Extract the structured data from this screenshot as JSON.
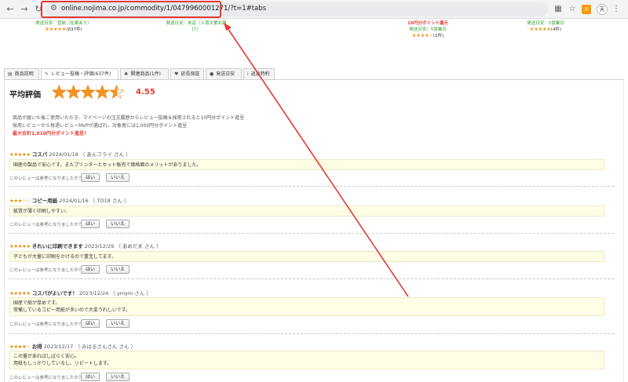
{
  "browser": {
    "url": "online.nojima.co.jp/commodity/1/0479960001271/?t=1#tabs",
    "avatar_text": "天",
    "extension_badge": "8",
    "icons": [
      "back-icon",
      "forward-icon",
      "reload-icon",
      "site-settings-icon",
      "qr-icon",
      "bookmark-star-icon",
      "extensions-icon",
      "avatar",
      "menu-icon"
    ]
  },
  "strip": [
    {
      "ship": "発送日安：翌納（在庫あり）",
      "stars": "★★★★★",
      "count": "(637件)"
    },
    {
      "ship": "発送日安：未定（入荷次第お届",
      "ship2": "け）",
      "stars": "",
      "count": ""
    },
    {
      "point": "10円分ポイント還元",
      "ship": "発送日安：5営業日",
      "stars": "★★★★☆",
      "count": "(1件)"
    },
    {
      "ship": "発送日安：5営業日",
      "stars": "★★★★★",
      "count": "(4件)"
    }
  ],
  "tabs": [
    {
      "icon": "▤",
      "label": "商品説明"
    },
    {
      "icon": "✎",
      "label": "レビュー投稿・評価(637件)"
    },
    {
      "icon": "♣",
      "label": "関連商品(1件)"
    },
    {
      "icon": "♥",
      "label": "延長保証"
    },
    {
      "icon": "●",
      "label": "発送日安"
    },
    {
      "icon": "i",
      "label": "返品特約"
    }
  ],
  "average": {
    "title": "平均評価",
    "score": "4.55",
    "rating": 4.55
  },
  "info": {
    "line1": "商品が届いた後ご使用いただき、マイページの注文履歴からレビュー投稿＆採用されると10円分ポイント進呈",
    "line2": "採用レビューから毎週レビューMVPが選ばれ、対象者には1,000円分ポイント進呈",
    "line3": "最大合計1,010円分ポイント進呈！"
  },
  "helpful_question": "このレビューは参考になりましたか？",
  "yes_label": "はい",
  "no_label": "いいえ",
  "reviews": [
    {
      "stars": "★★★★★",
      "title": "コスパ",
      "meta": "2024/01/18 （ あんフライ さん ）",
      "body": [
        "国産の製品で安心です。またプリンターとセット販売で価格面のメリットがありました。"
      ]
    },
    {
      "stars": "★★★☆☆",
      "title": "コピー用紙",
      "meta": "2024/01/16 （ TO18 さん ）",
      "body": [
        "紙質が薄く印刷しやすい。"
      ]
    },
    {
      "stars": "★★★★★",
      "title": "きれいに印刷できます",
      "meta": "2023/12/29 （ あめだま さん ）",
      "body": [
        "子どもが大量に印刷をかけるので重宝してます。"
      ]
    },
    {
      "stars": "★★★★★",
      "title": "コスパがよいです！",
      "meta": "2023/12/24 （ ymym さん ）",
      "body": [
        "国産で紙が厚めです。",
        "常備しているコピー用紙が多いので大変うれしいです。"
      ]
    },
    {
      "stars": "★★★★☆",
      "title": "お得",
      "meta": "2023/12/17 （ みはるさんさん さん ）",
      "body": [
        "この量があればしばらく安心。",
        "用紙もしっかりしているし、リピートします。"
      ]
    }
  ]
}
